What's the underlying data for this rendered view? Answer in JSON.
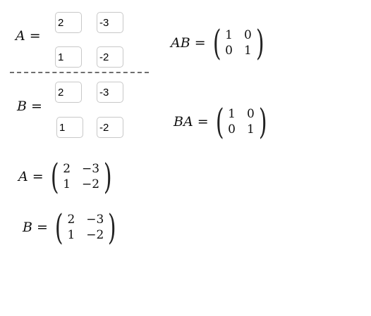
{
  "labels": {
    "a": "A",
    "b": "B",
    "ab": "AB",
    "ba": "BA",
    "eq": "="
  },
  "inputs": {
    "a": {
      "a11": "2",
      "a12": "-3",
      "a21": "1",
      "a22": "-2"
    },
    "b": {
      "b11": "2",
      "b12": "-3",
      "b21": "1",
      "b22": "-2"
    }
  },
  "products": {
    "ab": [
      [
        "1",
        "0"
      ],
      [
        "0",
        "1"
      ]
    ],
    "ba": [
      [
        "1",
        "0"
      ],
      [
        "0",
        "1"
      ]
    ]
  },
  "displays": {
    "a": [
      [
        "2",
        "−3"
      ],
      [
        "1",
        "−2"
      ]
    ],
    "b": [
      [
        "2",
        "−3"
      ],
      [
        "1",
        "−2"
      ]
    ]
  }
}
